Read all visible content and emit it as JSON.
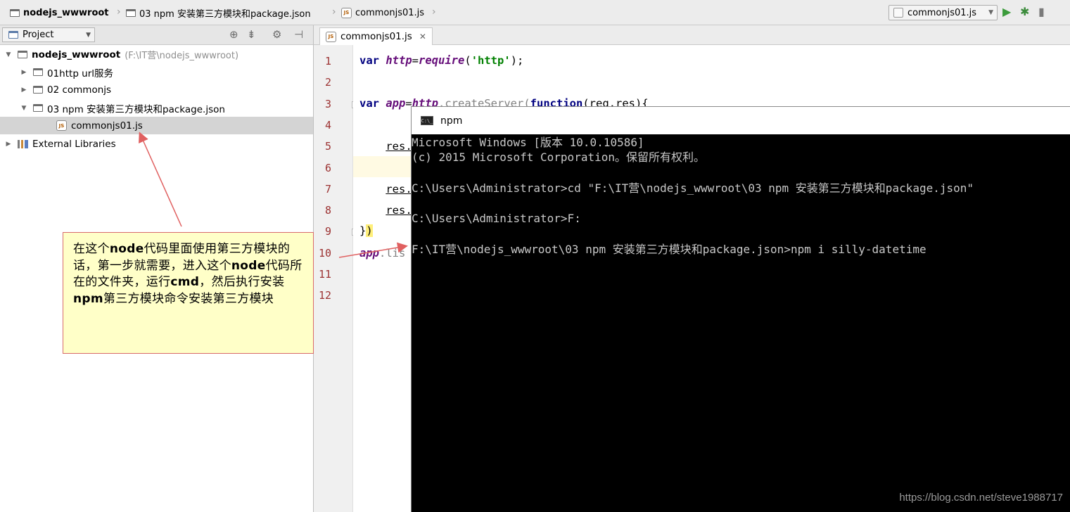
{
  "breadcrumb": {
    "items": [
      "nodejs_wwwroot",
      "03 npm 安装第三方模块和package.json",
      "commonjs01.js"
    ]
  },
  "toolbar": {
    "run_config": "commonjs01.js"
  },
  "project_panel": {
    "view_selector": "Project",
    "tree": [
      {
        "label": "nodejs_wwwroot",
        "hint": "(F:\\IT营\\nodejs_wwwroot)",
        "type": "folder",
        "expanded": true
      },
      {
        "label": "01http url服务",
        "type": "folder",
        "expanded": false
      },
      {
        "label": "02 commonjs",
        "type": "folder",
        "expanded": false
      },
      {
        "label": "03 npm 安装第三方模块和package.json",
        "type": "folder",
        "expanded": true
      },
      {
        "label": "commonjs01.js",
        "type": "js-file",
        "selected": true
      },
      {
        "label": "External Libraries",
        "type": "library",
        "expanded": false
      }
    ]
  },
  "editor": {
    "tab_label": "commonjs01.js",
    "file_badge": "JS",
    "line_numbers": [
      "1",
      "2",
      "3",
      "4",
      "5",
      "6",
      "7",
      "8",
      "9",
      "10",
      "11",
      "12"
    ],
    "code": {
      "l1_kw": "var",
      "l1_var": "http",
      "l1_eq": "=",
      "l1_fn": "require",
      "l1_open": "(",
      "l1_str": "'http'",
      "l1_close": ");",
      "l3_kw": "var",
      "l3_var": "app",
      "l3_eq": "=",
      "l3_obj": "http",
      "l3_method": ".createServer(",
      "l3_kw2": "function",
      "l3_args": "(req,res){",
      "l5": "res.",
      "l7": "res.",
      "l8": "res.",
      "l9_brace": "}",
      "l9_rest": ")",
      "l10_obj": "app",
      "l10_rest": ".lis"
    }
  },
  "console": {
    "title": "npm",
    "icon_text": "C:\\_",
    "lines": [
      "Microsoft Windows [版本 10.0.10586]",
      "(c) 2015 Microsoft Corporation。保留所有权利。",
      "C:\\Users\\Administrator>cd \"F:\\IT营\\nodejs_wwwroot\\03 npm 安装第三方模块和package.json\"",
      "C:\\Users\\Administrator>F:",
      "F:\\IT营\\nodejs_wwwroot\\03 npm 安装第三方模块和package.json>npm i silly-datetime"
    ]
  },
  "annotation": {
    "p1": "在这个",
    "b1": "node",
    "p2": "代码里面使用第三方模块的话，第一步就需要，进入这个",
    "b2": "node",
    "p3": "代码所在的文件夹，运行",
    "b3": "cmd",
    "p4": "，然后执行安装",
    "b4": "npm",
    "p5": "第三方模块命令安装第三方模块"
  },
  "watermark": "https://blog.csdn.net/steve1988717",
  "icons": [
    "folder-icon",
    "js-file-icon",
    "run-config-icon",
    "run-icon",
    "debug-icon",
    "project-view-icon",
    "target-icon",
    "collapse-icon",
    "gear-icon",
    "hide-panel-icon",
    "library-icon",
    "close-tab-icon",
    "cmd-icon"
  ],
  "colors": {
    "keyword": "#000080",
    "string": "#008000",
    "identifier": "#660e7a",
    "line_number": "#9c3232",
    "annotation_bg": "#ffffc8",
    "annotation_border": "#d86a6a",
    "console_bg": "#000000",
    "console_text": "#c8c8c8"
  }
}
